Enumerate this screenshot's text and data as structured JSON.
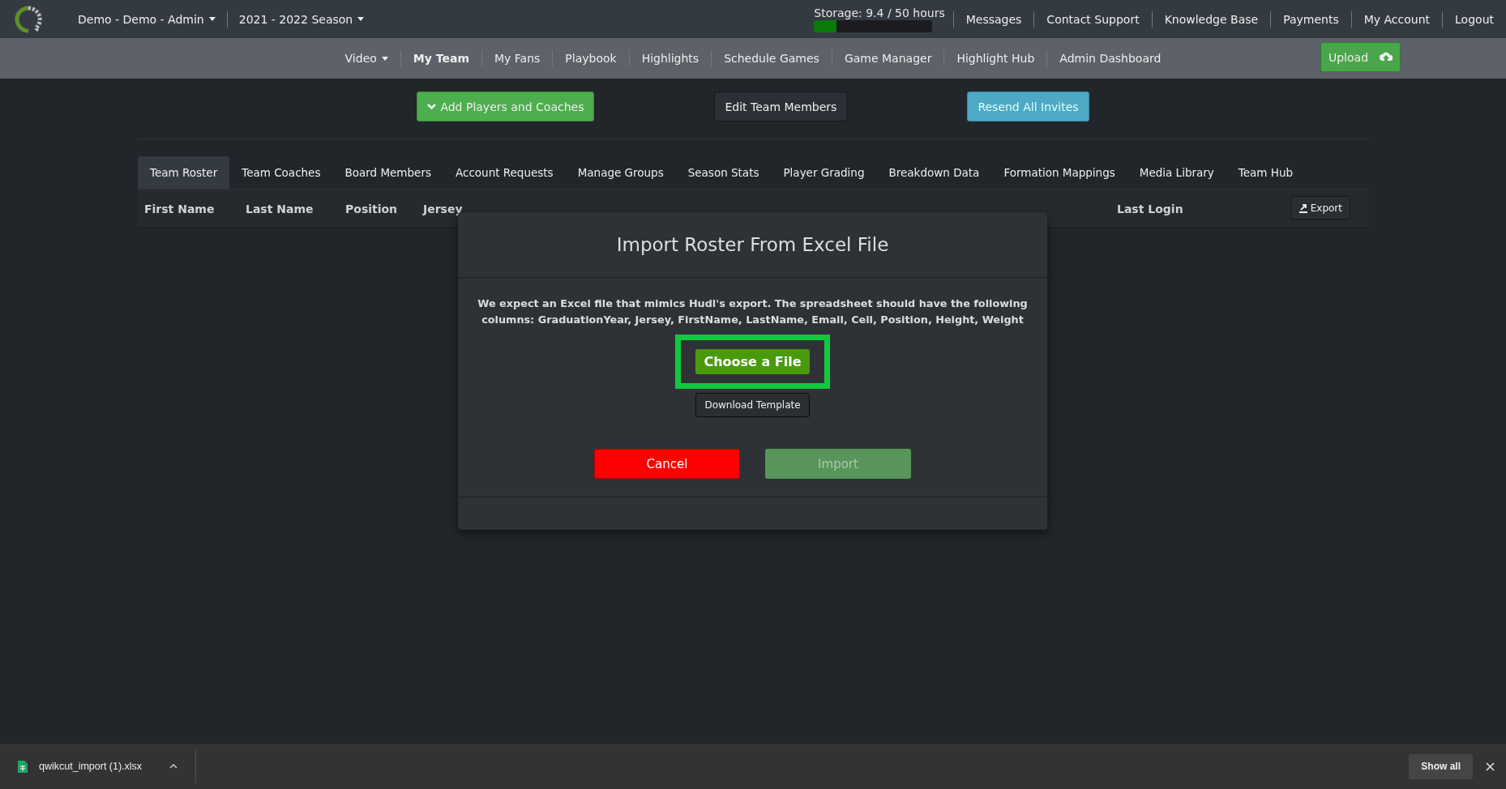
{
  "top_bar": {
    "account_menu": "Demo - Demo - Admin",
    "season_menu": "2021 - 2022 Season",
    "storage": {
      "label": "Storage: 9.4 / 50 hours",
      "level": 0.19
    },
    "links": [
      "Messages",
      "Contact Support",
      "Knowledge Base",
      "Payments",
      "My Account",
      "Logout"
    ]
  },
  "nav": {
    "items": [
      {
        "label": "Video",
        "kind": "dropdown",
        "selected": false
      },
      {
        "label": "My Team",
        "kind": "link",
        "selected": true
      },
      {
        "label": "My Fans",
        "kind": "link",
        "selected": false
      },
      {
        "label": "Playbook",
        "kind": "link",
        "selected": false
      },
      {
        "label": "Highlights",
        "kind": "link",
        "selected": false
      },
      {
        "label": "Schedule Games",
        "kind": "link",
        "selected": false
      },
      {
        "label": "Game Manager",
        "kind": "link",
        "selected": false
      },
      {
        "label": "Highlight Hub",
        "kind": "link",
        "selected": false
      },
      {
        "label": "Admin Dashboard",
        "kind": "link",
        "selected": false
      }
    ],
    "upload_button": "Upload"
  },
  "actions": [
    {
      "label": "Add Players and Coaches",
      "kind": "success"
    },
    {
      "label": "Edit Team Members",
      "kind": "default"
    },
    {
      "label": "Resend All Invites",
      "kind": "info"
    }
  ],
  "tabs": [
    {
      "label": "Team Roster",
      "selected": true
    },
    {
      "label": "Team Coaches",
      "selected": false
    },
    {
      "label": "Board Members",
      "selected": false
    },
    {
      "label": "Account Requests",
      "selected": false
    },
    {
      "label": "Manage Groups",
      "selected": false
    },
    {
      "label": "Season Stats",
      "selected": false
    },
    {
      "label": "Player Grading",
      "selected": false
    },
    {
      "label": "Breakdown Data",
      "selected": false
    },
    {
      "label": "Formation Mappings",
      "selected": false
    },
    {
      "label": "Media Library",
      "selected": false
    },
    {
      "label": "Team Hub",
      "selected": false
    }
  ],
  "table": {
    "columns": [
      "First Name",
      "Last Name",
      "Position",
      "Jersey",
      "Last Login"
    ],
    "export_button": "Export"
  },
  "modal": {
    "title": "Import Roster From Excel File",
    "description": "We expect an Excel file that mimics Hudl's export. The spreadsheet should have the following columns: GraduationYear, Jersey, FirstName, LastName, Email, Cell, Position, Height, Weight",
    "choose_button": "Choose a File",
    "template_button": "Download Template",
    "cancel_button": "Cancel",
    "import_button": {
      "label": "Import",
      "disabled": true
    }
  },
  "download_bar": {
    "file": "qwikcut_import (1).xlsx",
    "show_all": "Show all"
  }
}
